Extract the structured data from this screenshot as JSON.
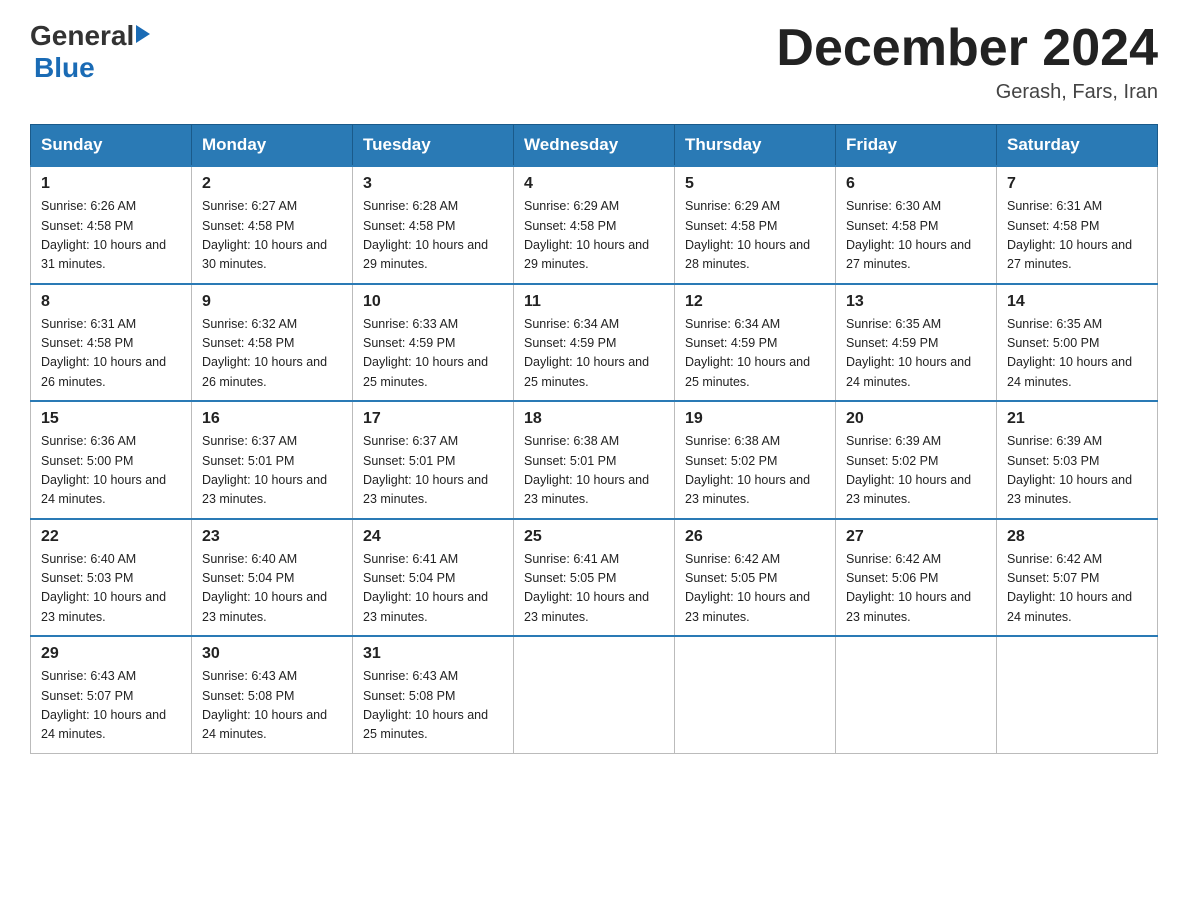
{
  "header": {
    "logo_general": "General",
    "logo_blue": "Blue",
    "month_title": "December 2024",
    "subtitle": "Gerash, Fars, Iran"
  },
  "days_of_week": [
    "Sunday",
    "Monday",
    "Tuesday",
    "Wednesday",
    "Thursday",
    "Friday",
    "Saturday"
  ],
  "weeks": [
    [
      {
        "day": "1",
        "sunrise": "6:26 AM",
        "sunset": "4:58 PM",
        "daylight": "10 hours and 31 minutes."
      },
      {
        "day": "2",
        "sunrise": "6:27 AM",
        "sunset": "4:58 PM",
        "daylight": "10 hours and 30 minutes."
      },
      {
        "day": "3",
        "sunrise": "6:28 AM",
        "sunset": "4:58 PM",
        "daylight": "10 hours and 29 minutes."
      },
      {
        "day": "4",
        "sunrise": "6:29 AM",
        "sunset": "4:58 PM",
        "daylight": "10 hours and 29 minutes."
      },
      {
        "day": "5",
        "sunrise": "6:29 AM",
        "sunset": "4:58 PM",
        "daylight": "10 hours and 28 minutes."
      },
      {
        "day": "6",
        "sunrise": "6:30 AM",
        "sunset": "4:58 PM",
        "daylight": "10 hours and 27 minutes."
      },
      {
        "day": "7",
        "sunrise": "6:31 AM",
        "sunset": "4:58 PM",
        "daylight": "10 hours and 27 minutes."
      }
    ],
    [
      {
        "day": "8",
        "sunrise": "6:31 AM",
        "sunset": "4:58 PM",
        "daylight": "10 hours and 26 minutes."
      },
      {
        "day": "9",
        "sunrise": "6:32 AM",
        "sunset": "4:58 PM",
        "daylight": "10 hours and 26 minutes."
      },
      {
        "day": "10",
        "sunrise": "6:33 AM",
        "sunset": "4:59 PM",
        "daylight": "10 hours and 25 minutes."
      },
      {
        "day": "11",
        "sunrise": "6:34 AM",
        "sunset": "4:59 PM",
        "daylight": "10 hours and 25 minutes."
      },
      {
        "day": "12",
        "sunrise": "6:34 AM",
        "sunset": "4:59 PM",
        "daylight": "10 hours and 25 minutes."
      },
      {
        "day": "13",
        "sunrise": "6:35 AM",
        "sunset": "4:59 PM",
        "daylight": "10 hours and 24 minutes."
      },
      {
        "day": "14",
        "sunrise": "6:35 AM",
        "sunset": "5:00 PM",
        "daylight": "10 hours and 24 minutes."
      }
    ],
    [
      {
        "day": "15",
        "sunrise": "6:36 AM",
        "sunset": "5:00 PM",
        "daylight": "10 hours and 24 minutes."
      },
      {
        "day": "16",
        "sunrise": "6:37 AM",
        "sunset": "5:01 PM",
        "daylight": "10 hours and 23 minutes."
      },
      {
        "day": "17",
        "sunrise": "6:37 AM",
        "sunset": "5:01 PM",
        "daylight": "10 hours and 23 minutes."
      },
      {
        "day": "18",
        "sunrise": "6:38 AM",
        "sunset": "5:01 PM",
        "daylight": "10 hours and 23 minutes."
      },
      {
        "day": "19",
        "sunrise": "6:38 AM",
        "sunset": "5:02 PM",
        "daylight": "10 hours and 23 minutes."
      },
      {
        "day": "20",
        "sunrise": "6:39 AM",
        "sunset": "5:02 PM",
        "daylight": "10 hours and 23 minutes."
      },
      {
        "day": "21",
        "sunrise": "6:39 AM",
        "sunset": "5:03 PM",
        "daylight": "10 hours and 23 minutes."
      }
    ],
    [
      {
        "day": "22",
        "sunrise": "6:40 AM",
        "sunset": "5:03 PM",
        "daylight": "10 hours and 23 minutes."
      },
      {
        "day": "23",
        "sunrise": "6:40 AM",
        "sunset": "5:04 PM",
        "daylight": "10 hours and 23 minutes."
      },
      {
        "day": "24",
        "sunrise": "6:41 AM",
        "sunset": "5:04 PM",
        "daylight": "10 hours and 23 minutes."
      },
      {
        "day": "25",
        "sunrise": "6:41 AM",
        "sunset": "5:05 PM",
        "daylight": "10 hours and 23 minutes."
      },
      {
        "day": "26",
        "sunrise": "6:42 AM",
        "sunset": "5:05 PM",
        "daylight": "10 hours and 23 minutes."
      },
      {
        "day": "27",
        "sunrise": "6:42 AM",
        "sunset": "5:06 PM",
        "daylight": "10 hours and 23 minutes."
      },
      {
        "day": "28",
        "sunrise": "6:42 AM",
        "sunset": "5:07 PM",
        "daylight": "10 hours and 24 minutes."
      }
    ],
    [
      {
        "day": "29",
        "sunrise": "6:43 AM",
        "sunset": "5:07 PM",
        "daylight": "10 hours and 24 minutes."
      },
      {
        "day": "30",
        "sunrise": "6:43 AM",
        "sunset": "5:08 PM",
        "daylight": "10 hours and 24 minutes."
      },
      {
        "day": "31",
        "sunrise": "6:43 AM",
        "sunset": "5:08 PM",
        "daylight": "10 hours and 25 minutes."
      },
      null,
      null,
      null,
      null
    ]
  ]
}
